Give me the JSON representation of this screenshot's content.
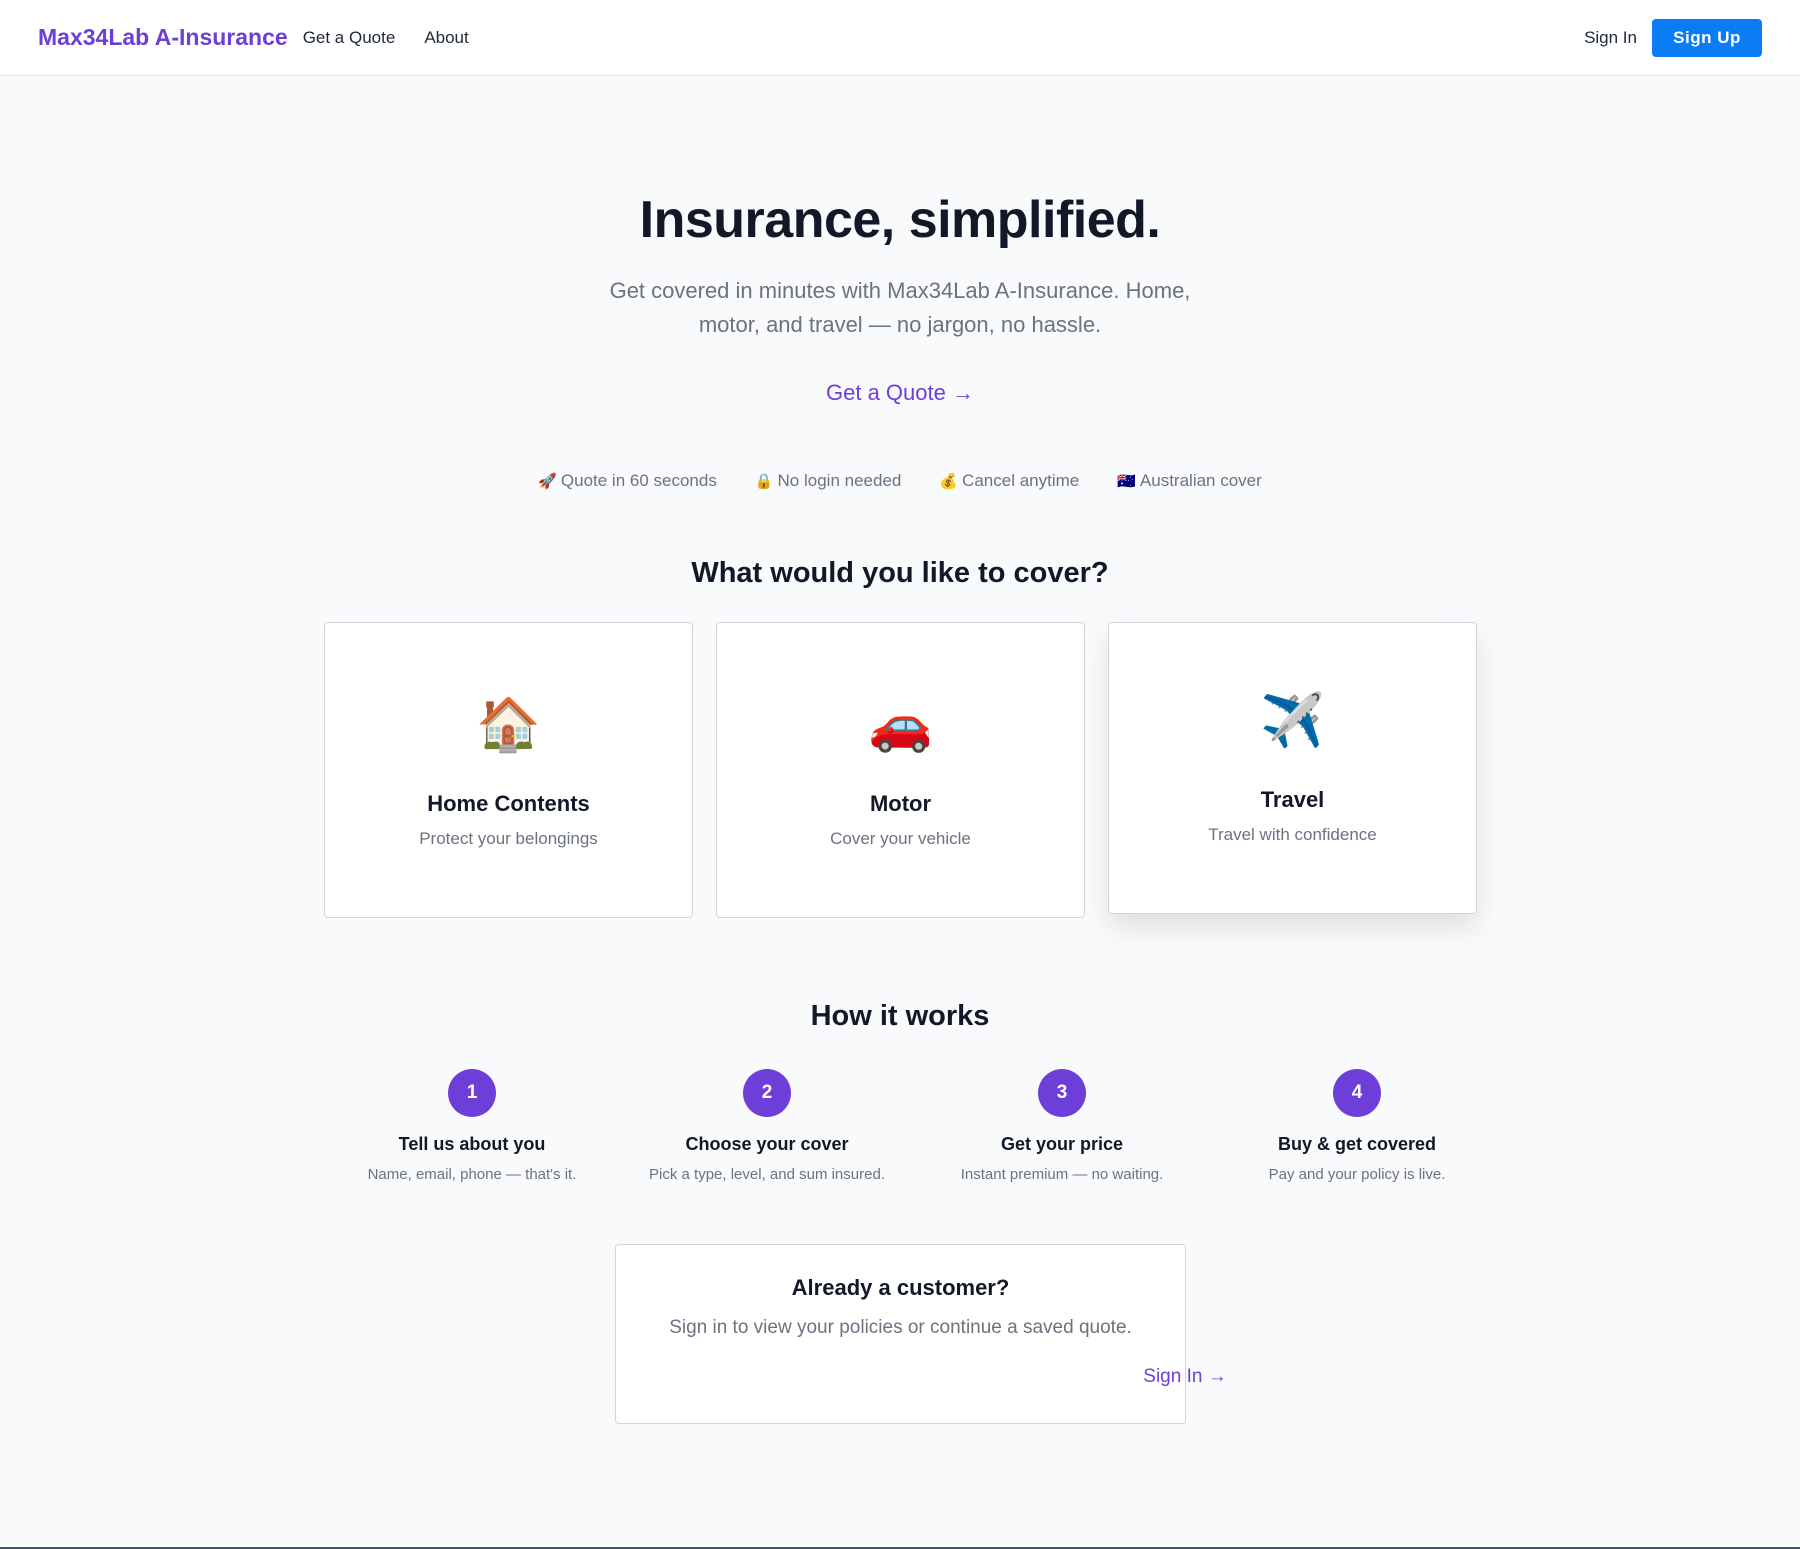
{
  "nav": {
    "brand": "Max34Lab A-Insurance",
    "links": [
      "Get a Quote",
      "About"
    ],
    "signin": "Sign In",
    "signup": "Sign Up"
  },
  "hero": {
    "title": "Insurance, simplified.",
    "subtitle": "Get covered in minutes with Max34Lab A-Insurance. Home, motor, and travel — no jargon, no hassle.",
    "cta": "Get a Quote →"
  },
  "badges": [
    {
      "icon": "🚀",
      "icon_name": "rocket-icon",
      "label": "Quote in 60 seconds"
    },
    {
      "icon": "🔒",
      "icon_name": "lock-icon",
      "label": "No login needed"
    },
    {
      "icon": "💰",
      "icon_name": "money-bag-icon",
      "label": "Cancel anytime"
    },
    {
      "icon": "🇦🇺",
      "icon_name": "australia-flag-icon",
      "label": "Australian cover"
    }
  ],
  "cover": {
    "title": "What would you like to cover?",
    "cards": [
      {
        "icon": "🏠",
        "icon_name": "house-icon",
        "title": "Home Contents",
        "desc": "Protect your belongings"
      },
      {
        "icon": "🚗",
        "icon_name": "car-icon",
        "title": "Motor",
        "desc": "Cover your vehicle"
      },
      {
        "icon": "✈️",
        "icon_name": "airplane-icon",
        "title": "Travel",
        "desc": "Travel with confidence"
      }
    ]
  },
  "how": {
    "title": "How it works",
    "steps": [
      {
        "num": "1",
        "title": "Tell us about you",
        "desc": "Name, email, phone — that's it."
      },
      {
        "num": "2",
        "title": "Choose your cover",
        "desc": "Pick a type, level, and sum insured."
      },
      {
        "num": "3",
        "title": "Get your price",
        "desc": "Instant premium — no waiting."
      },
      {
        "num": "4",
        "title": "Buy & get covered",
        "desc": "Pay and your policy is live."
      }
    ]
  },
  "customer": {
    "title": "Already a customer?",
    "desc": "Sign in to view your policies or continue a saved quote.",
    "link": "Sign In →"
  },
  "colors": {
    "accent": "#6d3fd8",
    "signup": "#0b7cf5",
    "background": "#f9fafb"
  }
}
